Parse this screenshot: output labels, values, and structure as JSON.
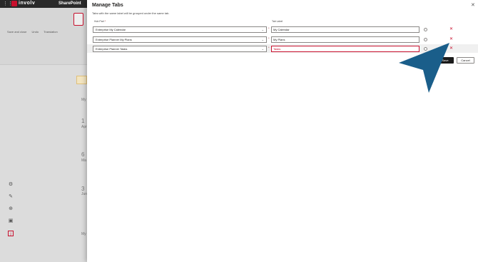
{
  "suite_bar": {
    "brand": "involv",
    "app": "SharePoint"
  },
  "background_app": {
    "toolbar": [
      "Save and close",
      "Undo",
      "Translation"
    ],
    "calendar_label": "My",
    "dates": [
      {
        "day": "1",
        "month": "Apr"
      },
      {
        "day": "6",
        "month": "Ma"
      },
      {
        "day": "3",
        "month": "Jun"
      }
    ],
    "bottom_label": "My"
  },
  "panel": {
    "title": "Manage Tabs",
    "description": "Tabs with the same label will be grouped under the same tab.",
    "col_hub": "Hub Part",
    "col_hub_required": "*",
    "col_tab": "Tab Label",
    "close_glyph": "✕",
    "rows": [
      {
        "hub": "Enterprise My Calendar",
        "tab": "My Calendar",
        "error": false
      },
      {
        "hub": "Enterprise Planner My Plans",
        "tab": "My Plans",
        "error": false
      },
      {
        "hub": "Enterprise Planner Tasks",
        "tab": "Tasks",
        "error": true
      }
    ],
    "delete_glyph": "✕",
    "chevron_glyph": "⌄",
    "save_label": "Save",
    "cancel_label": "Cancel"
  },
  "colors": {
    "accent": "#c8102e",
    "pointer": "#1a5e8a"
  }
}
